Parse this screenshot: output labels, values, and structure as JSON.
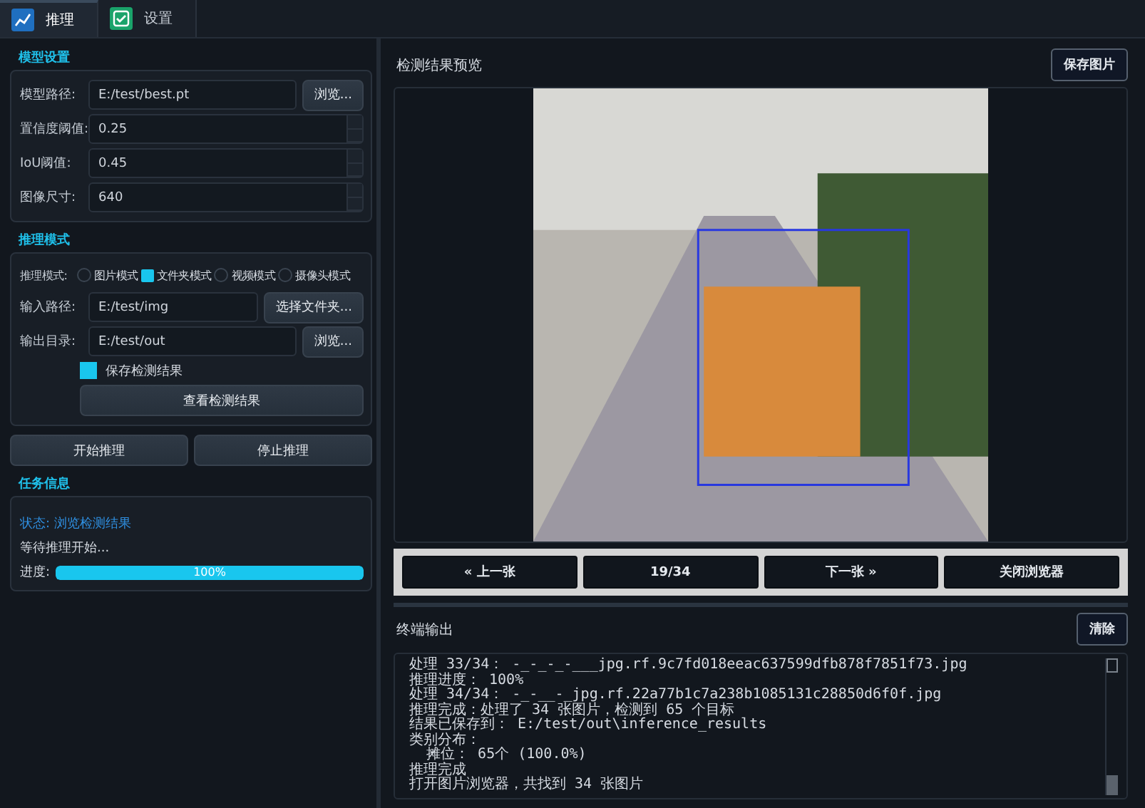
{
  "tabs": [
    {
      "label": "推理",
      "kind": "chart",
      "selected": true
    },
    {
      "label": "设置",
      "kind": "check",
      "selected": false
    }
  ],
  "model_settings": {
    "title": "模型设置",
    "fields": [
      {
        "kind": "path",
        "label": "模型路径:",
        "value": "E:/test/best.pt",
        "button": "浏览..."
      },
      {
        "kind": "spin",
        "label": "置信度阈值:",
        "value": "0.25"
      },
      {
        "kind": "spin",
        "label": "IoU阈值:",
        "value": "0.45"
      },
      {
        "kind": "spin",
        "label": "图像尺寸:",
        "value": "640"
      }
    ]
  },
  "inference_mode": {
    "title": "推理模式",
    "mode_label": "推理模式:",
    "modes": [
      {
        "label": "图片模式",
        "selected": false
      },
      {
        "label": "文件夹模式",
        "selected": true
      },
      {
        "label": "视频模式",
        "selected": false
      },
      {
        "label": "摄像头模式",
        "selected": false
      }
    ],
    "paths": [
      {
        "label": "输入路径:",
        "value": "E:/test/img",
        "button": "选择文件夹..."
      },
      {
        "label": "输出目录:",
        "value": "E:/test/out",
        "button": "浏览..."
      }
    ],
    "save_results": {
      "label": "保存检测结果",
      "checked": true
    },
    "view_button": "查看检测结果"
  },
  "actions": [
    "开始推理",
    "停止推理"
  ],
  "task_info": {
    "title": "任务信息",
    "status": "状态: 浏览检测结果",
    "message": "等待推理开始...",
    "progress_label": "进度:",
    "progress": {
      "level": 1,
      "text": "100%"
    }
  },
  "preview": {
    "title": "检测结果预览",
    "save_button": "保存图片",
    "nav": [
      "« 上一张",
      "19/34",
      "下一张 »",
      "关闭浏览器"
    ]
  },
  "terminal": {
    "title": "终端输出",
    "clear_button": "清除",
    "lines": [
      "处理 33/34： -_-_-_-___jpg.rf.9c7fd018eeac637599dfb878f7851f73.jpg",
      "推理进度： 100%",
      "处理 34/34： -_-__-_jpg.rf.22a77b1c7a238b1085131c28850d6f0f.jpg",
      "推理完成：处理了 34 张图片，检测到 65 个目标",
      "结果已保存到： E:/test/out\\inference_results",
      "类别分布：",
      "  摊位： 65个 (100.0%)",
      "推理完成",
      "打开图片浏览器，共找到 34 张图片"
    ]
  }
}
